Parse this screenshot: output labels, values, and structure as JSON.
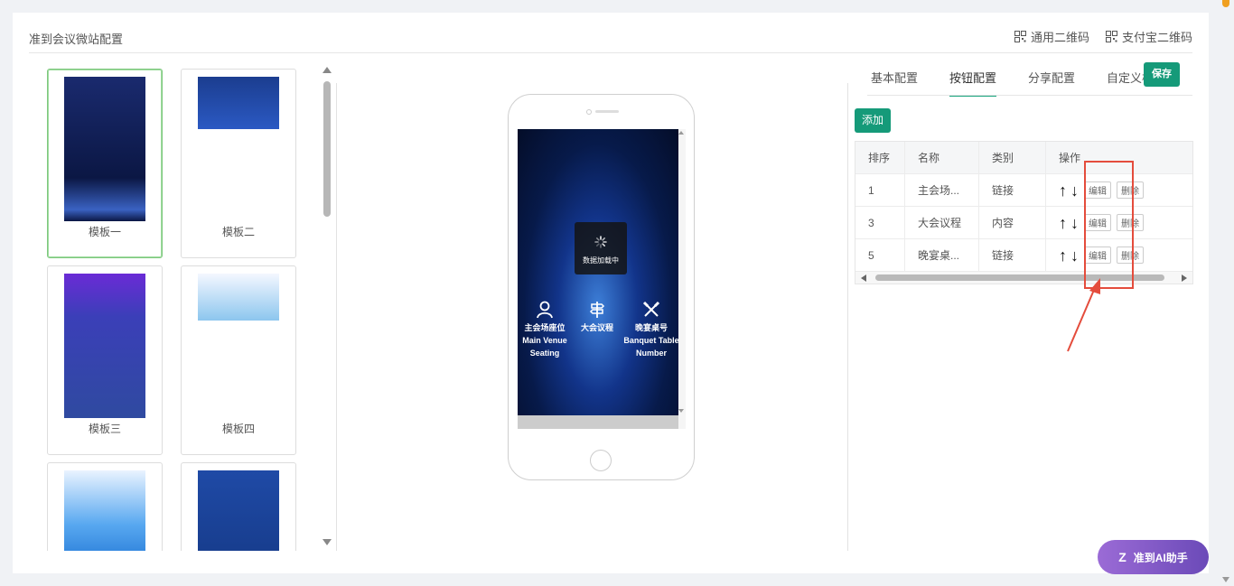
{
  "header": {
    "title": "准到会议微站配置",
    "links": [
      {
        "label": "通用二维码",
        "icon": "qr-code-icon"
      },
      {
        "label": "支付宝二维码",
        "icon": "qr-code-icon"
      }
    ]
  },
  "templates": [
    {
      "label": "模板一",
      "selected": true
    },
    {
      "label": "模板二",
      "selected": false
    },
    {
      "label": "模板三",
      "selected": false
    },
    {
      "label": "模板四",
      "selected": false
    },
    {
      "label": "",
      "selected": false
    },
    {
      "label": "",
      "selected": false
    }
  ],
  "preview": {
    "loading_text": "数据加载中",
    "buttons": [
      {
        "label_cn": "主会场座位",
        "label_en": "Main Venue Seating",
        "icon": "person-icon"
      },
      {
        "label_cn": "大会议程",
        "label_en": "",
        "icon": "signpost-icon"
      },
      {
        "label_cn": "晚宴桌号",
        "label_en": "Banquet Table Number",
        "icon": "fork-knife-icon"
      }
    ]
  },
  "config": {
    "tabs": [
      {
        "label": "基本配置",
        "active": false
      },
      {
        "label": "按钮配置",
        "active": true
      },
      {
        "label": "分享配置",
        "active": false
      },
      {
        "label": "自定义样",
        "active": false
      }
    ],
    "save_label": "保存",
    "add_label": "添加",
    "table": {
      "headers": [
        "排序",
        "名称",
        "类别",
        "操作"
      ],
      "rows": [
        {
          "order": "1",
          "name": "主会场...",
          "type": "链接"
        },
        {
          "order": "3",
          "name": "大会议程",
          "type": "内容"
        },
        {
          "order": "5",
          "name": "晚宴桌...",
          "type": "链接"
        }
      ],
      "up_arrow": "↑",
      "down_arrow": "↓",
      "edit_label": "编辑",
      "delete_label": "删除"
    }
  },
  "assistant": {
    "label": "准到AI助手",
    "icon_text": "Z"
  },
  "colors": {
    "accent": "#159a79",
    "highlight": "#e44c3c"
  }
}
